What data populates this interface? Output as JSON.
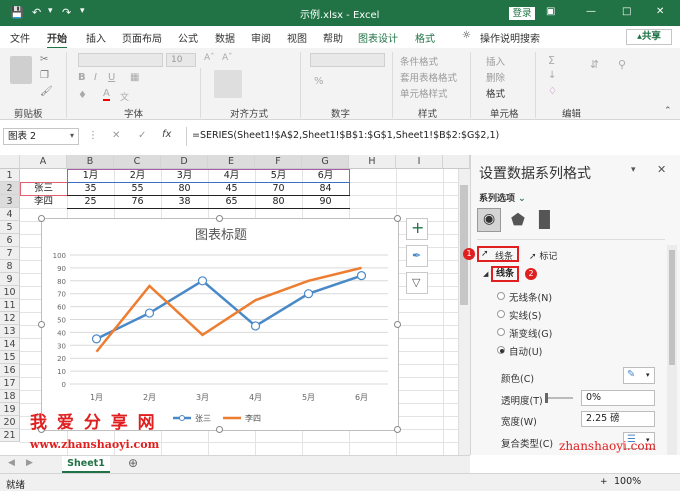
{
  "window": {
    "title": "示例.xlsx  -  Excel",
    "login_label": "登录"
  },
  "tabs": [
    "文件",
    "开始",
    "插入",
    "页面布局",
    "公式",
    "数据",
    "审阅",
    "视图",
    "帮助",
    "图表设计",
    "格式"
  ],
  "search_label": "操作说明搜索",
  "share_label": "共享",
  "ribbon": {
    "groups": [
      "剪贴板",
      "字体",
      "对齐方式",
      "数字",
      "样式",
      "单元格",
      "编辑"
    ],
    "styles_items": [
      "条件格式",
      "套用表格格式",
      "单元格样式"
    ],
    "cells_items": [
      "插入",
      "删除",
      "格式"
    ],
    "font_size": "10",
    "percent": "%"
  },
  "formula_bar": {
    "name_box": "图表 2",
    "fx": "fx",
    "formula": "=SERIES(Sheet1!$A$2,Sheet1!$B$1:$G$1,Sheet1!$B$2:$G$2,1)"
  },
  "sheet": {
    "columns": [
      "A",
      "B",
      "C",
      "D",
      "E",
      "F",
      "G",
      "H",
      "I"
    ],
    "rows": [
      "1",
      "2",
      "3",
      "4",
      "5",
      "6",
      "7",
      "8",
      "9",
      "10",
      "11",
      "12",
      "13",
      "14",
      "15",
      "16",
      "17",
      "18",
      "19",
      "20",
      "21"
    ],
    "header_row": [
      "1月",
      "2月",
      "3月",
      "4月",
      "5月",
      "6月"
    ],
    "data_rows": [
      {
        "name": "张三",
        "values": [
          "35",
          "55",
          "80",
          "45",
          "70",
          "84"
        ]
      },
      {
        "name": "李四",
        "values": [
          "25",
          "76",
          "38",
          "65",
          "80",
          "90"
        ]
      }
    ],
    "tab_name": "Sheet1"
  },
  "chart_data": {
    "type": "line",
    "title": "图表标题",
    "categories": [
      "1月",
      "2月",
      "3月",
      "4月",
      "5月",
      "6月"
    ],
    "ylim": [
      0,
      100
    ],
    "yticks": [
      "0",
      "10",
      "20",
      "30",
      "40",
      "50",
      "60",
      "70",
      "80",
      "90",
      "100"
    ],
    "series": [
      {
        "name": "张三",
        "values": [
          35,
          55,
          80,
          45,
          70,
          84
        ],
        "color": "#4a89c8"
      },
      {
        "name": "李四",
        "values": [
          25,
          76,
          38,
          65,
          80,
          90
        ],
        "color": "#ed7d31"
      }
    ],
    "legend": "bottom",
    "grid": true
  },
  "watermark": {
    "brand": "我 爱 分 享 网",
    "url": "www.zhanshaoyi.com",
    "url2": "zhanshaoyi.com"
  },
  "pane": {
    "title": "设置数据系列格式",
    "series_options": "系列选项",
    "tab_line": "线条",
    "tab_marker": "标记",
    "section_line": "线条",
    "badge1": "1",
    "badge2": "2",
    "radios": [
      "无线条(N)",
      "实线(S)",
      "渐变线(G)",
      "自动(U)"
    ],
    "color_label": "颜色(C)",
    "transparency_label": "透明度(T)",
    "transparency_value": "0%",
    "width_label": "宽度(W)",
    "width_value": "2.25 磅",
    "compound_label": "复合类型(C)"
  },
  "status": {
    "ready": "就绪",
    "zoom": "100%"
  },
  "colors": {
    "excel_green": "#217346",
    "accent_red": "#e02020"
  }
}
